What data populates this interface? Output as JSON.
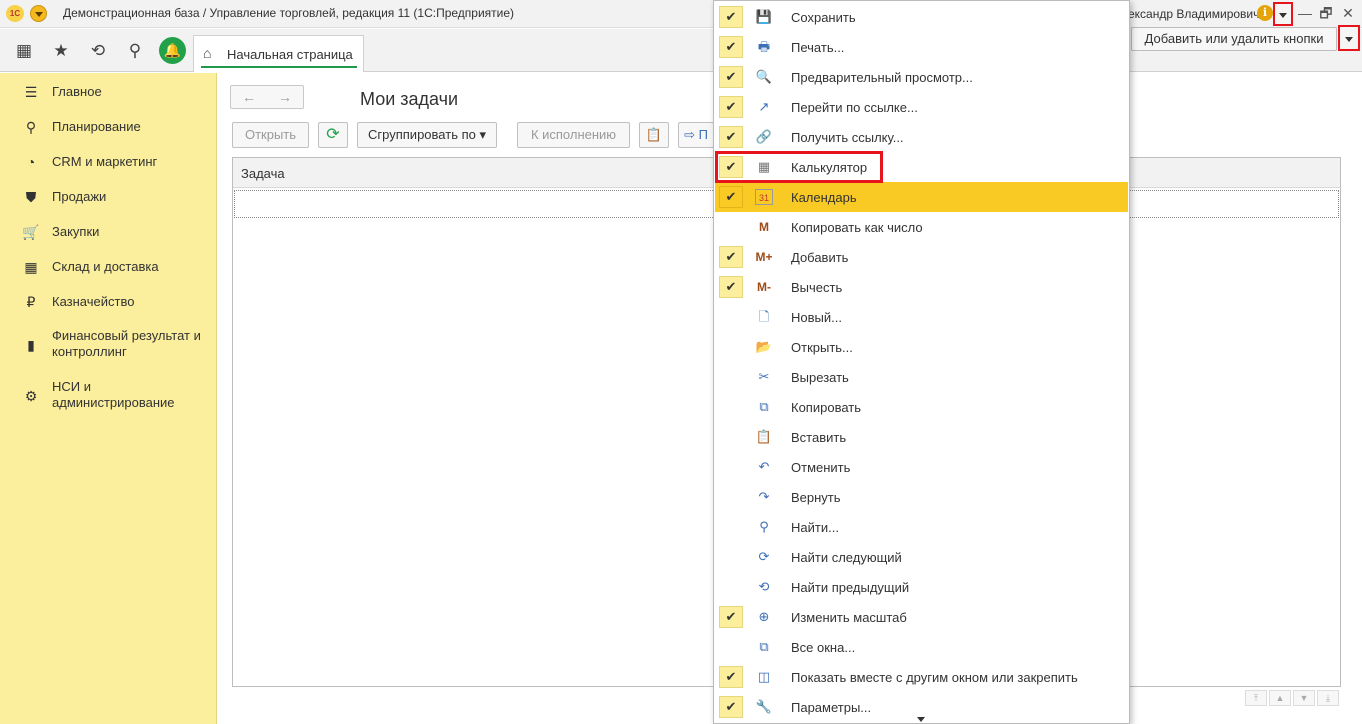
{
  "window": {
    "logo": "1С",
    "title": "Демонстрационная база / Управление торговлей, редакция 11  (1С:Предприятие)",
    "user": "ександр Владимирович",
    "info_glyph": "i",
    "minimize": "—",
    "maximize": "🗗",
    "close": "✕"
  },
  "toolbar": {
    "apps_icon": "▦",
    "favorites_icon": "★",
    "history_icon": "⟲",
    "search_icon": "⚲",
    "bell_icon": "🔔",
    "home_tab_label": "Начальная страница",
    "add_remove_label": "Добавить или удалить кнопки"
  },
  "sidebar": {
    "items": [
      {
        "icon": "☰",
        "label": "Главное"
      },
      {
        "icon": "⚲",
        "label": "Планирование"
      },
      {
        "icon": "◔",
        "label": "CRM и маркетинг"
      },
      {
        "icon": "⛊",
        "label": "Продажи"
      },
      {
        "icon": "🛒",
        "label": "Закупки"
      },
      {
        "icon": "▦",
        "label": "Склад и доставка"
      },
      {
        "icon": "₽",
        "label": "Казначейство"
      },
      {
        "icon": "▮",
        "label": "Финансовый результат и контроллинг"
      },
      {
        "icon": "⚙",
        "label": "НСИ и администрирование"
      }
    ]
  },
  "content": {
    "back_arrow": "←",
    "forward_arrow": "→",
    "page_title": "Мои задачи",
    "open_label": "Открыть",
    "refresh_icon": "⟳",
    "group_label": "Сгруппировать по ▾",
    "execute_label": "К исполнению",
    "clipboard_icon": "📋",
    "next_label": "⇨ П",
    "column_task": "Задача",
    "scroll": [
      "⤒",
      "▲",
      "▼",
      "⤓"
    ]
  },
  "menu": {
    "items": [
      {
        "checked": true,
        "icon": "💾",
        "label": "Сохранить"
      },
      {
        "checked": true,
        "icon": "🖶",
        "label": "Печать..."
      },
      {
        "checked": true,
        "icon": "🔍",
        "label": "Предварительный просмотр..."
      },
      {
        "checked": true,
        "icon": "↗",
        "label": "Перейти по ссылке..."
      },
      {
        "checked": true,
        "icon": "🔗",
        "label": "Получить ссылку..."
      },
      {
        "checked": true,
        "icon": "▦",
        "label": "Калькулятор"
      },
      {
        "checked": true,
        "icon": "31",
        "label": "Календарь",
        "highlight": true
      },
      {
        "checked": false,
        "icon": "M",
        "label": "Копировать как число"
      },
      {
        "checked": true,
        "icon": "M+",
        "label": "Добавить"
      },
      {
        "checked": true,
        "icon": "M-",
        "label": "Вычесть"
      },
      {
        "checked": false,
        "icon": "🗋",
        "label": "Новый..."
      },
      {
        "checked": false,
        "icon": "📂",
        "label": "Открыть..."
      },
      {
        "checked": false,
        "icon": "✂",
        "label": "Вырезать"
      },
      {
        "checked": false,
        "icon": "⧉",
        "label": "Копировать"
      },
      {
        "checked": false,
        "icon": "📋",
        "label": "Вставить"
      },
      {
        "checked": false,
        "icon": "↶",
        "label": "Отменить"
      },
      {
        "checked": false,
        "icon": "↷",
        "label": "Вернуть"
      },
      {
        "checked": false,
        "icon": "⚲",
        "label": "Найти..."
      },
      {
        "checked": false,
        "icon": "⟳",
        "label": "Найти следующий"
      },
      {
        "checked": false,
        "icon": "⟲",
        "label": "Найти предыдущий"
      },
      {
        "checked": true,
        "icon": "⊕",
        "label": "Изменить масштаб"
      },
      {
        "checked": false,
        "icon": "⧉",
        "label": "Все окна..."
      },
      {
        "checked": true,
        "icon": "◫",
        "label": "Показать вместе с другим окном или закрепить"
      },
      {
        "checked": true,
        "icon": "🔧",
        "label": "Параметры..."
      }
    ],
    "check_glyph": "✔"
  }
}
